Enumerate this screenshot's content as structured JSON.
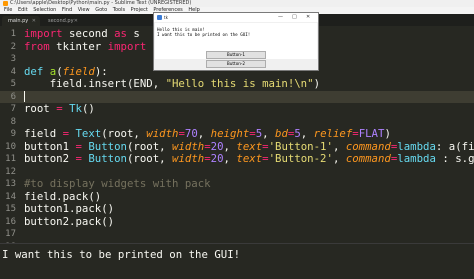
{
  "window": {
    "title": "C:\\Users\\apple\\Desktop\\Python\\main.py - Sublime Text (UNREGISTERED)"
  },
  "menu": [
    "File",
    "Edit",
    "Selection",
    "Find",
    "View",
    "Goto",
    "Tools",
    "Project",
    "Preferences",
    "Help"
  ],
  "tabs": [
    {
      "label": "main.py",
      "active": true
    },
    {
      "label": "second.py",
      "active": false
    }
  ],
  "editor": {
    "line_numbers": [
      "1",
      "2",
      "3",
      "4",
      "5",
      "6",
      "7",
      "8",
      "9",
      "10",
      "11",
      "12",
      "13",
      "14",
      "15",
      "16",
      "17",
      "18"
    ],
    "current_line": 6,
    "lines": [
      [
        {
          "t": "import",
          "c": "kw"
        },
        {
          "t": " second ",
          "c": ""
        },
        {
          "t": "as",
          "c": "kw"
        },
        {
          "t": " s",
          "c": ""
        }
      ],
      [
        {
          "t": "from",
          "c": "kw"
        },
        {
          "t": " tkinter ",
          "c": ""
        },
        {
          "t": "import",
          "c": "kw"
        },
        {
          "t": " ",
          "c": ""
        },
        {
          "t": "*",
          "c": "kw"
        }
      ],
      [],
      [
        {
          "t": "def",
          "c": "fn"
        },
        {
          "t": " ",
          "c": ""
        },
        {
          "t": "a",
          "c": "def"
        },
        {
          "t": "(",
          "c": ""
        },
        {
          "t": "field",
          "c": "arg"
        },
        {
          "t": "):",
          "c": ""
        }
      ],
      [
        {
          "t": "    field.insert(END, ",
          "c": ""
        },
        {
          "t": "\"Hello this is main!\\n\"",
          "c": "str"
        },
        {
          "t": ")",
          "c": ""
        }
      ],
      [],
      [
        {
          "t": "root ",
          "c": ""
        },
        {
          "t": "=",
          "c": "kw"
        },
        {
          "t": " ",
          "c": ""
        },
        {
          "t": "Tk",
          "c": "fn"
        },
        {
          "t": "()",
          "c": ""
        }
      ],
      [],
      [
        {
          "t": "field ",
          "c": ""
        },
        {
          "t": "=",
          "c": "kw"
        },
        {
          "t": " ",
          "c": ""
        },
        {
          "t": "Text",
          "c": "fn"
        },
        {
          "t": "(root, ",
          "c": ""
        },
        {
          "t": "width",
          "c": "arg"
        },
        {
          "t": "=",
          "c": "kw"
        },
        {
          "t": "70",
          "c": "num"
        },
        {
          "t": ", ",
          "c": ""
        },
        {
          "t": "height",
          "c": "arg"
        },
        {
          "t": "=",
          "c": "kw"
        },
        {
          "t": "5",
          "c": "num"
        },
        {
          "t": ", ",
          "c": ""
        },
        {
          "t": "bd",
          "c": "arg"
        },
        {
          "t": "=",
          "c": "kw"
        },
        {
          "t": "5",
          "c": "num"
        },
        {
          "t": ", ",
          "c": ""
        },
        {
          "t": "relief",
          "c": "arg"
        },
        {
          "t": "=",
          "c": "kw"
        },
        {
          "t": "FLAT",
          "c": "num"
        },
        {
          "t": ")",
          "c": ""
        }
      ],
      [
        {
          "t": "button1 ",
          "c": ""
        },
        {
          "t": "=",
          "c": "kw"
        },
        {
          "t": " ",
          "c": ""
        },
        {
          "t": "Button",
          "c": "fn"
        },
        {
          "t": "(root, ",
          "c": ""
        },
        {
          "t": "width",
          "c": "arg"
        },
        {
          "t": "=",
          "c": "kw"
        },
        {
          "t": "20",
          "c": "num"
        },
        {
          "t": ", ",
          "c": ""
        },
        {
          "t": "text",
          "c": "arg"
        },
        {
          "t": "=",
          "c": "kw"
        },
        {
          "t": "'Button-1'",
          "c": "str"
        },
        {
          "t": ", ",
          "c": ""
        },
        {
          "t": "command",
          "c": "arg"
        },
        {
          "t": "=",
          "c": "kw"
        },
        {
          "t": "lambda",
          "c": "fn"
        },
        {
          "t": ": a(field))",
          "c": ""
        }
      ],
      [
        {
          "t": "button2 ",
          "c": ""
        },
        {
          "t": "=",
          "c": "kw"
        },
        {
          "t": " ",
          "c": ""
        },
        {
          "t": "Button",
          "c": "fn"
        },
        {
          "t": "(root, ",
          "c": ""
        },
        {
          "t": "width",
          "c": "arg"
        },
        {
          "t": "=",
          "c": "kw"
        },
        {
          "t": "20",
          "c": "num"
        },
        {
          "t": ", ",
          "c": ""
        },
        {
          "t": "text",
          "c": "arg"
        },
        {
          "t": "=",
          "c": "kw"
        },
        {
          "t": "'Button-2'",
          "c": "str"
        },
        {
          "t": ", ",
          "c": ""
        },
        {
          "t": "command",
          "c": "arg"
        },
        {
          "t": "=",
          "c": "kw"
        },
        {
          "t": "lambda",
          "c": "fn"
        },
        {
          "t": " : s.go(fie",
          "c": ""
        }
      ],
      [],
      [
        {
          "t": "#to display widgets with pack",
          "c": "cm"
        }
      ],
      [
        {
          "t": "field.pack()",
          "c": ""
        }
      ],
      [
        {
          "t": "button1.pack()",
          "c": ""
        }
      ],
      [
        {
          "t": "button2.pack()",
          "c": ""
        }
      ],
      [],
      []
    ]
  },
  "console": {
    "output": "I want this to be printed on the GUI!"
  },
  "tk_window": {
    "title": "tk",
    "controls": [
      "—",
      "□",
      "✕"
    ],
    "text_lines": [
      "Hello this is main!",
      "I want this to be printed on the GUI!"
    ],
    "button1_label": "Button-1",
    "button2_label": "Button-2"
  }
}
